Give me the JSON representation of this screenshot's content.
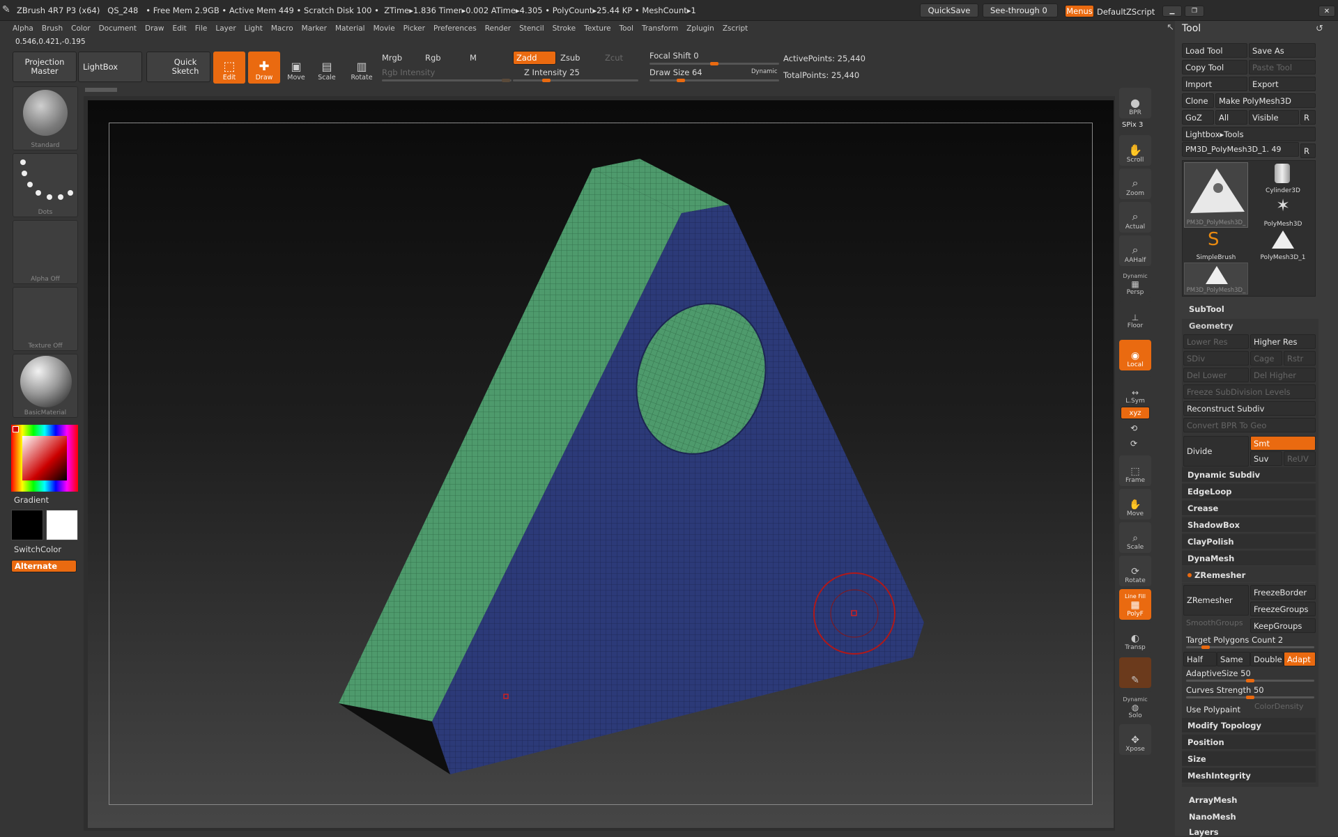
{
  "title_bar": {
    "text": "ZBrush 4R7 P3 (x64)   QS_248   • Free Mem 2.9GB • Active Mem 449 • Scratch Disk 100 •  ZTime▸1.836 Timer▸0.002 ATime▸4.305 • PolyCount▸25.44 KP • MeshCount▸1",
    "quicksave": "QuickSave",
    "see_through": "See-through  0",
    "menus": "Menus",
    "script": "DefaultZScript"
  },
  "menu_bar": [
    "Alpha",
    "Brush",
    "Color",
    "Document",
    "Draw",
    "Edit",
    "File",
    "Layer",
    "Light",
    "Macro",
    "Marker",
    "Material",
    "Movie",
    "Picker",
    "Preferences",
    "Render",
    "Stencil",
    "Stroke",
    "Texture",
    "Tool",
    "Transform",
    "Zplugin",
    "Zscript"
  ],
  "coordinates": "0.546,0.421,-0.195",
  "toolbar": {
    "projection_master": "Projection Master",
    "lightbox": "LightBox",
    "quick_sketch": "Quick Sketch",
    "edit": "Edit",
    "draw": "Draw",
    "move": "Move",
    "scale": "Scale",
    "rotate": "Rotate",
    "mrgb": "Mrgb",
    "rgb": "Rgb",
    "m": "M",
    "rgb_intensity": "Rgb Intensity",
    "zadd": "Zadd",
    "zsub": "Zsub",
    "zcut": "Zcut",
    "z_intensity": "Z Intensity 25",
    "focal_shift": "Focal Shift 0",
    "draw_size": "Draw Size 64",
    "dynamic": "Dynamic",
    "active_points": "ActivePoints: 25,440",
    "total_points": "TotalPoints: 25,440",
    "z_intensity_value": 25,
    "focal_shift_value": 0,
    "draw_size_value": 64
  },
  "left_shelf": {
    "brush": "Standard",
    "stroke": "Dots",
    "alpha": "Alpha Off",
    "texture": "Texture Off",
    "material": "BasicMaterial",
    "gradient": "Gradient",
    "switch_color": "SwitchColor",
    "alternate": "Alternate"
  },
  "right_shelf": [
    "BPR",
    "SPix 3",
    "Scroll",
    "Zoom",
    "Actual",
    "AAHalf",
    "Dynamic",
    "Persp",
    "Floor",
    "Local",
    "L.Sym",
    "Frame",
    "Move",
    "Scale",
    "Rotate",
    "Line Fill",
    "PolyF",
    "Transp",
    "Dynamic",
    "Solo",
    "Xpose"
  ],
  "tool_panel": {
    "title": "Tool",
    "load_tool": "Load Tool",
    "save_as": "Save As",
    "copy_tool": "Copy Tool",
    "paste_tool": "Paste Tool",
    "import": "Import",
    "export": "Export",
    "clone": "Clone",
    "make_polymesh": "Make PolyMesh3D",
    "goz": "GoZ",
    "all": "All",
    "visible": "Visible",
    "r": "R",
    "lightbox_tools": "Lightbox▸Tools",
    "current_tool": "PM3D_PolyMesh3D_1. 49",
    "tools": [
      "PM3D_PolyMesh3D_",
      "Cylinder3D",
      "PolyMesh3D",
      "SimpleBrush",
      "PolyMesh3D_1",
      "PM3D_PolyMesh3D_"
    ],
    "subtool": "SubTool",
    "geometry": "Geometry",
    "lower_res": "Lower Res",
    "higher_res": "Higher Res",
    "sdiv": "SDiv",
    "cage": "Cage",
    "rstr": "Rstr",
    "del_lower": "Del Lower",
    "del_higher": "Del Higher",
    "freeze_subdiv": "Freeze SubDivision Levels",
    "reconstruct_subdiv": "Reconstruct Subdiv",
    "convert_bpr": "Convert BPR To Geo",
    "divide": "Divide",
    "smt": "Smt",
    "suv": "Suv",
    "reuv": "ReUV",
    "dynamic_subdiv": "Dynamic Subdiv",
    "edgeloop": "EdgeLoop",
    "crease": "Crease",
    "shadowbox": "ShadowBox",
    "claypolish": "ClayPolish",
    "dynamesh": "DynaMesh",
    "zremesher_section": "ZRemesher",
    "zremesher_btn": "ZRemesher",
    "freeze_border": "FreezeBorder",
    "freeze_groups": "FreezeGroups",
    "smooth_groups": "SmoothGroups",
    "keep_groups": "KeepGroups",
    "target_polygons": "Target Polygons Count 2",
    "half": "Half",
    "same": "Same",
    "double": "Double",
    "adapt": "Adapt",
    "adaptive_size": "AdaptiveSize 50",
    "curves_strength": "Curves Strength 50",
    "use_polypaint": "Use Polypaint",
    "color_density": "ColorDensity",
    "modify_topology": "Modify Topology",
    "position": "Position",
    "size": "Size",
    "mesh_integrity": "MeshIntegrity",
    "arraymesh": "ArrayMesh",
    "nanomesh": "NanoMesh",
    "layers": "Layers"
  },
  "colors": {
    "accent": "#ea6a10",
    "face_green": "#4e9a6c",
    "face_blue": "#2c3a78"
  }
}
